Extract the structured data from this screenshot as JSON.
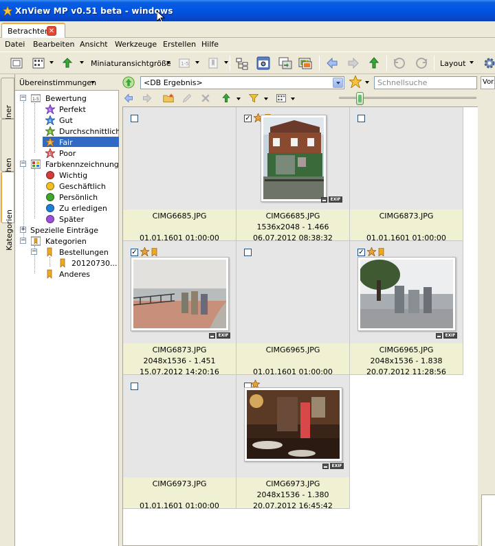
{
  "window": {
    "title": "XnView MP v0.51 beta - windows"
  },
  "tabs": [
    {
      "label": "Betrachter"
    }
  ],
  "menu": [
    "Datei",
    "Bearbeiten",
    "Ansicht",
    "Werkzeuge",
    "Erstellen",
    "Hilfe"
  ],
  "toolbar": {
    "thumb_size_label": "Miniaturansichtgröße",
    "layout_label": "Layout"
  },
  "side_tabs": [
    "Ordner",
    "Lesezeichen",
    "Kategorien"
  ],
  "left_panel": {
    "header": "Übereinstimmungen",
    "tree": {
      "bewertung": {
        "label": "Bewertung",
        "items": [
          "Perfekt",
          "Gut",
          "Durchschnittlich",
          "Fair",
          "Poor"
        ],
        "selected": "Fair"
      },
      "farben": {
        "label": "Farbkennzeichnung",
        "items": [
          "Wichtig",
          "Geschäftlich",
          "Persönlich",
          "Zu erledigen",
          "Später"
        ],
        "colors": [
          "#d23c3c",
          "#f0c020",
          "#3fa52c",
          "#1f7fd8",
          "#9b4fd6"
        ]
      },
      "speziell": {
        "label": "Spezielle Einträge"
      },
      "kategorien": {
        "label": "Kategorien",
        "children": [
          {
            "label": "Bestellungen",
            "children": [
              "20120730..."
            ]
          },
          {
            "label": "Anderes"
          }
        ]
      }
    }
  },
  "browser": {
    "path": "<DB Ergebnis>",
    "search_placeholder": "Schnellsuche",
    "preview_tab": "Vors",
    "zoom_fraction": 0.13
  },
  "thumbnails": [
    {
      "name": "CIMG6685.JPG",
      "dims": "",
      "date": "01.01.1601 01:00:00",
      "checked": false
    },
    {
      "name": "CIMG6685.JPG",
      "dims": "1536x2048 - 1.466",
      "date": "06.07.2012 08:38:32",
      "checked": true,
      "rating": true,
      "flag": true
    },
    {
      "name": "CIMG6873.JPG",
      "dims": "",
      "date": "01.01.1601 01:00:00",
      "checked": false
    },
    {
      "name": "CIMG6873.JPG",
      "dims": "2048x1536 - 1.451",
      "date": "15.07.2012 14:20:16",
      "checked": true,
      "rating": true,
      "flag": true
    },
    {
      "name": "CIMG6965.JPG",
      "dims": "",
      "date": "01.01.1601 01:00:00",
      "checked": false
    },
    {
      "name": "CIMG6965.JPG",
      "dims": "2048x1536 - 1.838",
      "date": "20.07.2012 11:28:56",
      "checked": true,
      "rating": true,
      "flag": true
    },
    {
      "name": "CIMG6973.JPG",
      "dims": "",
      "date": "01.01.1601 01:00:00",
      "checked": false
    },
    {
      "name": "CIMG6973.JPG",
      "dims": "2048x1536 - 1.380",
      "date": "20.07.2012 16:45:42",
      "checked": false,
      "rating": true,
      "flag": false
    }
  ],
  "badges": {
    "exif": "EXIF"
  }
}
